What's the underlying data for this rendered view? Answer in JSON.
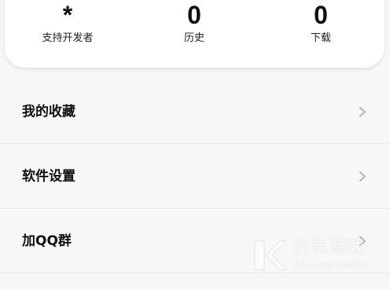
{
  "stats": [
    {
      "value": "*",
      "label": "支持开发者"
    },
    {
      "value": "0",
      "label": "历史"
    },
    {
      "value": "0",
      "label": "下载"
    }
  ],
  "menu": [
    {
      "label": "我的收藏",
      "icon": "chevron-right-icon"
    },
    {
      "label": "软件设置",
      "icon": "chevron-right-icon"
    },
    {
      "label": "加QQ群",
      "icon": "chevron-right-icon"
    }
  ],
  "watermark": {
    "name_cn": "仍玩游戏",
    "name_en": "Rengwan Games"
  },
  "colors": {
    "page_bg": "#f7f7f7",
    "card_bg": "#ffffff",
    "text": "#111111",
    "chevron": "#b5b5b5",
    "divider": "#e8e8e8"
  }
}
